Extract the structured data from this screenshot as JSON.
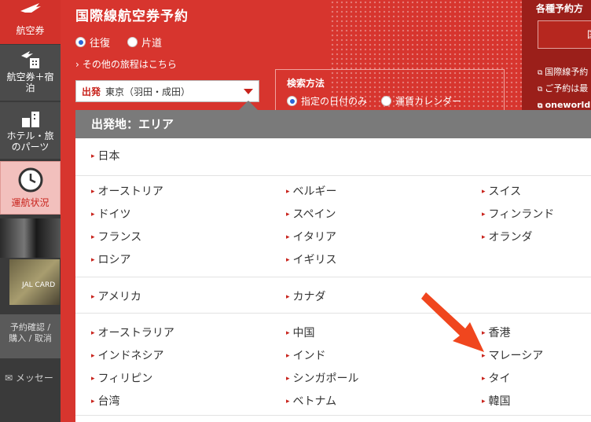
{
  "sidebar": {
    "items": [
      {
        "label": "航空券"
      },
      {
        "label": "航空券＋宿泊"
      },
      {
        "label": "ホテル・旅のパーツ"
      },
      {
        "label": "運航状況"
      }
    ],
    "card_label": "JAL CARD",
    "booking_label": "予約確認 / 購入 / 取消",
    "message_label": "メッセー"
  },
  "header": {
    "title": "国際線航空券予約",
    "trip_types": [
      {
        "label": "往復",
        "selected": true
      },
      {
        "label": "片道",
        "selected": false
      }
    ],
    "other_link": "その他の旅程はこちら",
    "departure": {
      "label": "出発",
      "value": "東京（羽田・成田）"
    },
    "search_method": {
      "title": "検索方法",
      "options": [
        {
          "label": "指定の日付のみ",
          "selected": true
        },
        {
          "label": "運賃カレンダー",
          "selected": false
        }
      ]
    }
  },
  "right_panel": {
    "title": "各種予約方",
    "button_label": "国",
    "links": [
      "国際線予約",
      "ご予約は最",
      "oneworld"
    ]
  },
  "dropdown": {
    "header": "出発地：エリア",
    "regions": [
      {
        "cells": [
          "日本"
        ]
      },
      {
        "cells": [
          "オーストリア",
          "ベルギー",
          "スイス",
          "ドイツ",
          "スペイン",
          "フィンランド",
          "フランス",
          "イタリア",
          "オランダ",
          "ロシア",
          "イギリス"
        ]
      },
      {
        "cells": [
          "アメリカ",
          "カナダ"
        ]
      },
      {
        "cells": [
          "オーストラリア",
          "中国",
          "香港",
          "インドネシア",
          "インド",
          "マレーシア",
          "フィリピン",
          "シンガポール",
          "タイ",
          "台湾",
          "ベトナム",
          "韓国"
        ]
      }
    ]
  },
  "colors": {
    "brand_red": "#d7352e",
    "dark_red": "#9b1f1a",
    "dropdown_header": "#7a7a7a",
    "annotation_arrow": "#f0461e"
  }
}
